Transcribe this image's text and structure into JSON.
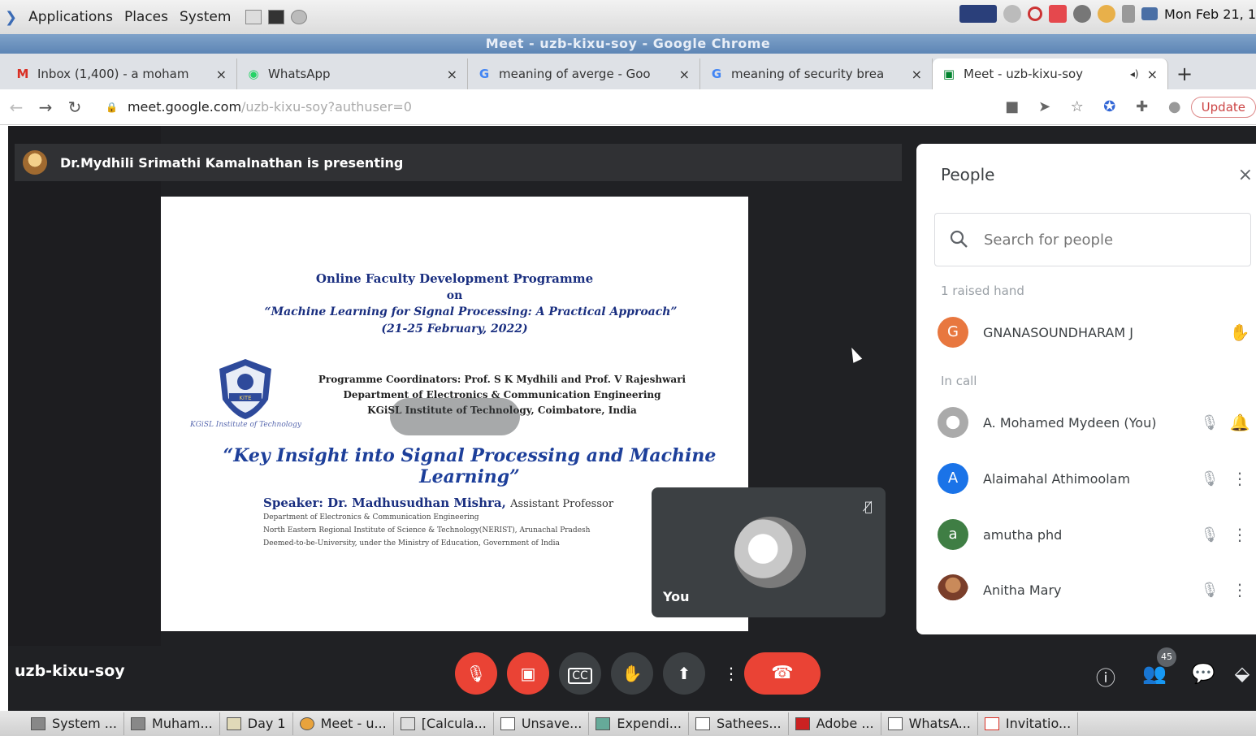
{
  "top_panel": {
    "menus": [
      "Applications",
      "Places",
      "System"
    ],
    "clock": "Mon Feb 21, 1"
  },
  "window_title": "Meet - uzb-kixu-soy - Google Chrome",
  "tabs": [
    {
      "favicon": "M",
      "title": "Inbox (1,400) - a moham",
      "close": "×"
    },
    {
      "favicon": "◉",
      "title": "WhatsApp",
      "close": "×"
    },
    {
      "favicon": "G",
      "title": "meaning of averge - Goo",
      "close": "×"
    },
    {
      "favicon": "G",
      "title": "meaning of security brea",
      "close": "×"
    },
    {
      "favicon": "▣",
      "title": "Meet - uzb-kixu-soy",
      "close": "×"
    }
  ],
  "new_tab": "+",
  "address": {
    "host": "meet.google.com",
    "path": "/uzb-kixu-soy?authuser=0",
    "update_label": "Update"
  },
  "presenting": {
    "text": "Dr.Mydhili Srimathi Kamalnathan is presenting"
  },
  "slide": {
    "line1": "Online Faculty Development Programme",
    "line2": "on",
    "line3": "“Machine Learning for Signal Processing: A Practical Approach”",
    "line4": "(21-25 February, 2022)",
    "logo_text": "KGiSL Institute of Technology",
    "coord1": "Programme Coordinators: Prof. S K Mydhili and Prof. V Rajeshwari",
    "coord2": "Department of Electronics & Communication Engineering",
    "coord3": "KGiSL Institute of Technology, Coimbatore, India",
    "title": "“Key Insight into Signal Processing and Machine Learning”",
    "speaker": "Speaker: Dr. Madhusudhan Mishra,",
    "speaker_role": "Assistant Professor",
    "detail1": "Department of Electronics & Communication Engineering",
    "detail2": "North Eastern Regional Institute of Science & Technology(NERIST), Arunachal Pradesh",
    "detail3": "Deemed-to-be-University, under the Ministry of Education, Government of India"
  },
  "self_tile": {
    "name": "You"
  },
  "people_panel": {
    "title": "People",
    "close": "×",
    "search_placeholder": "Search for people",
    "raised_label": "1 raised hand",
    "raised": [
      {
        "initial": "G",
        "name": "GNANASOUNDHARAM J",
        "avatar_color": "#e8773f",
        "action": "✋"
      }
    ],
    "in_call_label": "In call",
    "in_call": [
      {
        "initial": "",
        "name": "A. Mohamed Mydeen (You)",
        "avatar_color": "#d0d0d0",
        "action": "🔔"
      },
      {
        "initial": "A",
        "name": "Alaimahal Athimoolam",
        "avatar_color": "#1a73e8",
        "action": "⋮"
      },
      {
        "initial": "a",
        "name": "amutha phd",
        "avatar_color": "#3f7e44",
        "action": "⋮"
      },
      {
        "initial": "",
        "name": "Anitha Mary",
        "avatar_color": "#b8876a",
        "action": "⋮"
      }
    ]
  },
  "controls": {
    "meeting_code": "uzb-kixu-soy",
    "people_count": "45"
  },
  "taskbar": [
    "System ...",
    "Muham...",
    "Day 1",
    "Meet - u...",
    "[Calcula...",
    "Unsave...",
    "Expendi...",
    "Sathees...",
    "Adobe ...",
    "WhatsA...",
    "Invitatio..."
  ],
  "colors": {
    "meet_bg": "#202124",
    "danger": "#ea4335",
    "title_bar": "#5d85b5"
  }
}
